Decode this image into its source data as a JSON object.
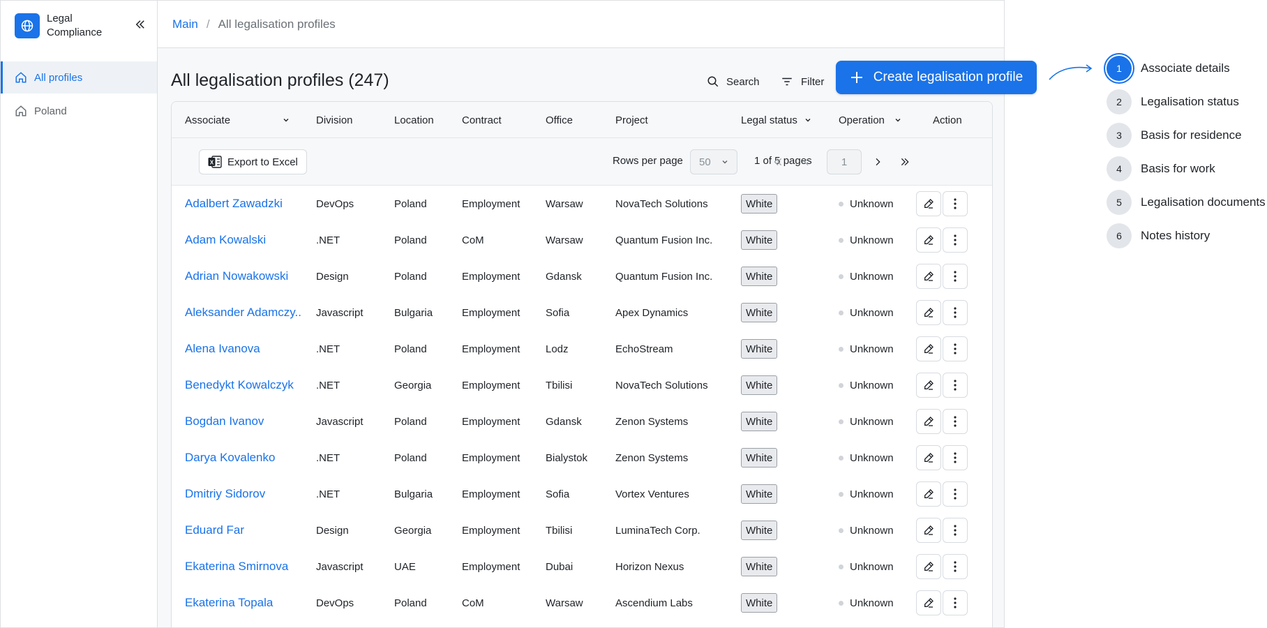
{
  "app": {
    "brand": "Legal Compliance",
    "brand_color": "#1a73e8"
  },
  "sidebar": {
    "items": [
      {
        "label": "All profiles",
        "icon": "home-icon",
        "active": true
      },
      {
        "label": "Poland",
        "icon": "home-icon",
        "active": false
      }
    ]
  },
  "breadcrumb": {
    "root": "Main",
    "separator": "/",
    "current": "All legalisation profiles"
  },
  "page": {
    "title": "All legalisation profiles (247)",
    "search_label": "Search",
    "filter_label": "Filter",
    "create_label": "Create legalisation profile"
  },
  "table": {
    "columns": [
      "Associate",
      "Division",
      "Location",
      "Contract",
      "Office",
      "Project",
      "Legal status",
      "Operation",
      "Action"
    ],
    "export_label": "Export to Excel",
    "rows_per_page_label": "Rows per page",
    "rows_per_page_value": "50",
    "pages_text": "1 of 5 pages",
    "page_value": "1",
    "rows": [
      {
        "associate": "Adalbert Zawadzki",
        "division": "DevOps",
        "location": "Poland",
        "contract": "Employment",
        "office": "Warsaw",
        "project": "NovaTech Solutions",
        "legal_status": "White",
        "operation": "Unknown"
      },
      {
        "associate": "Adam Kowalski",
        "division": ".NET",
        "location": "Poland",
        "contract": "CoM",
        "office": "Warsaw",
        "project": "Quantum Fusion Inc.",
        "legal_status": "White",
        "operation": "Unknown"
      },
      {
        "associate": "Adrian Nowakowski",
        "division": "Design",
        "location": "Poland",
        "contract": "Employment",
        "office": "Gdansk",
        "project": "Quantum Fusion Inc.",
        "legal_status": "White",
        "operation": "Unknown"
      },
      {
        "associate": "Aleksander Adamczy..",
        "division": "Javascript",
        "location": "Bulgaria",
        "contract": "Employment",
        "office": "Sofia",
        "project": "Apex Dynamics",
        "legal_status": "White",
        "operation": "Unknown"
      },
      {
        "associate": "Alena Ivanova",
        "division": ".NET",
        "location": "Poland",
        "contract": "Employment",
        "office": "Lodz",
        "project": "EchoStream",
        "legal_status": "White",
        "operation": "Unknown"
      },
      {
        "associate": "Benedykt Kowalczyk",
        "division": ".NET",
        "location": "Georgia",
        "contract": "Employment",
        "office": "Tbilisi",
        "project": "NovaTech Solutions",
        "legal_status": "White",
        "operation": "Unknown"
      },
      {
        "associate": "Bogdan Ivanov",
        "division": "Javascript",
        "location": "Poland",
        "contract": "Employment",
        "office": "Gdansk",
        "project": "Zenon Systems",
        "legal_status": "White",
        "operation": "Unknown"
      },
      {
        "associate": "Darya Kovalenko",
        "division": ".NET",
        "location": "Poland",
        "contract": "Employment",
        "office": "Bialystok",
        "project": "Zenon Systems",
        "legal_status": "White",
        "operation": "Unknown"
      },
      {
        "associate": "Dmitriy Sidorov",
        "division": ".NET",
        "location": "Bulgaria",
        "contract": "Employment",
        "office": "Sofia",
        "project": "Vortex Ventures",
        "legal_status": "White",
        "operation": "Unknown"
      },
      {
        "associate": "Eduard Far",
        "division": "Design",
        "location": "Georgia",
        "contract": "Employment",
        "office": "Tbilisi",
        "project": "LuminaTech Corp.",
        "legal_status": "White",
        "operation": "Unknown"
      },
      {
        "associate": "Ekaterina Smirnova",
        "division": "Javascript",
        "location": "UAE",
        "contract": "Employment",
        "office": "Dubai",
        "project": "Horizon Nexus",
        "legal_status": "White",
        "operation": "Unknown"
      },
      {
        "associate": "Ekaterina Topala",
        "division": "DevOps",
        "location": "Poland",
        "contract": "CoM",
        "office": "Warsaw",
        "project": "Ascendium Labs",
        "legal_status": "White",
        "operation": "Unknown"
      }
    ]
  },
  "stepper": {
    "steps": [
      {
        "number": "1",
        "label": "Associate details",
        "active": true
      },
      {
        "number": "2",
        "label": "Legalisation status",
        "active": false
      },
      {
        "number": "3",
        "label": "Basis for residence",
        "active": false
      },
      {
        "number": "4",
        "label": "Basis for work",
        "active": false
      },
      {
        "number": "5",
        "label": "Legalisation documents",
        "active": false
      },
      {
        "number": "6",
        "label": "Notes history",
        "active": false
      }
    ]
  }
}
